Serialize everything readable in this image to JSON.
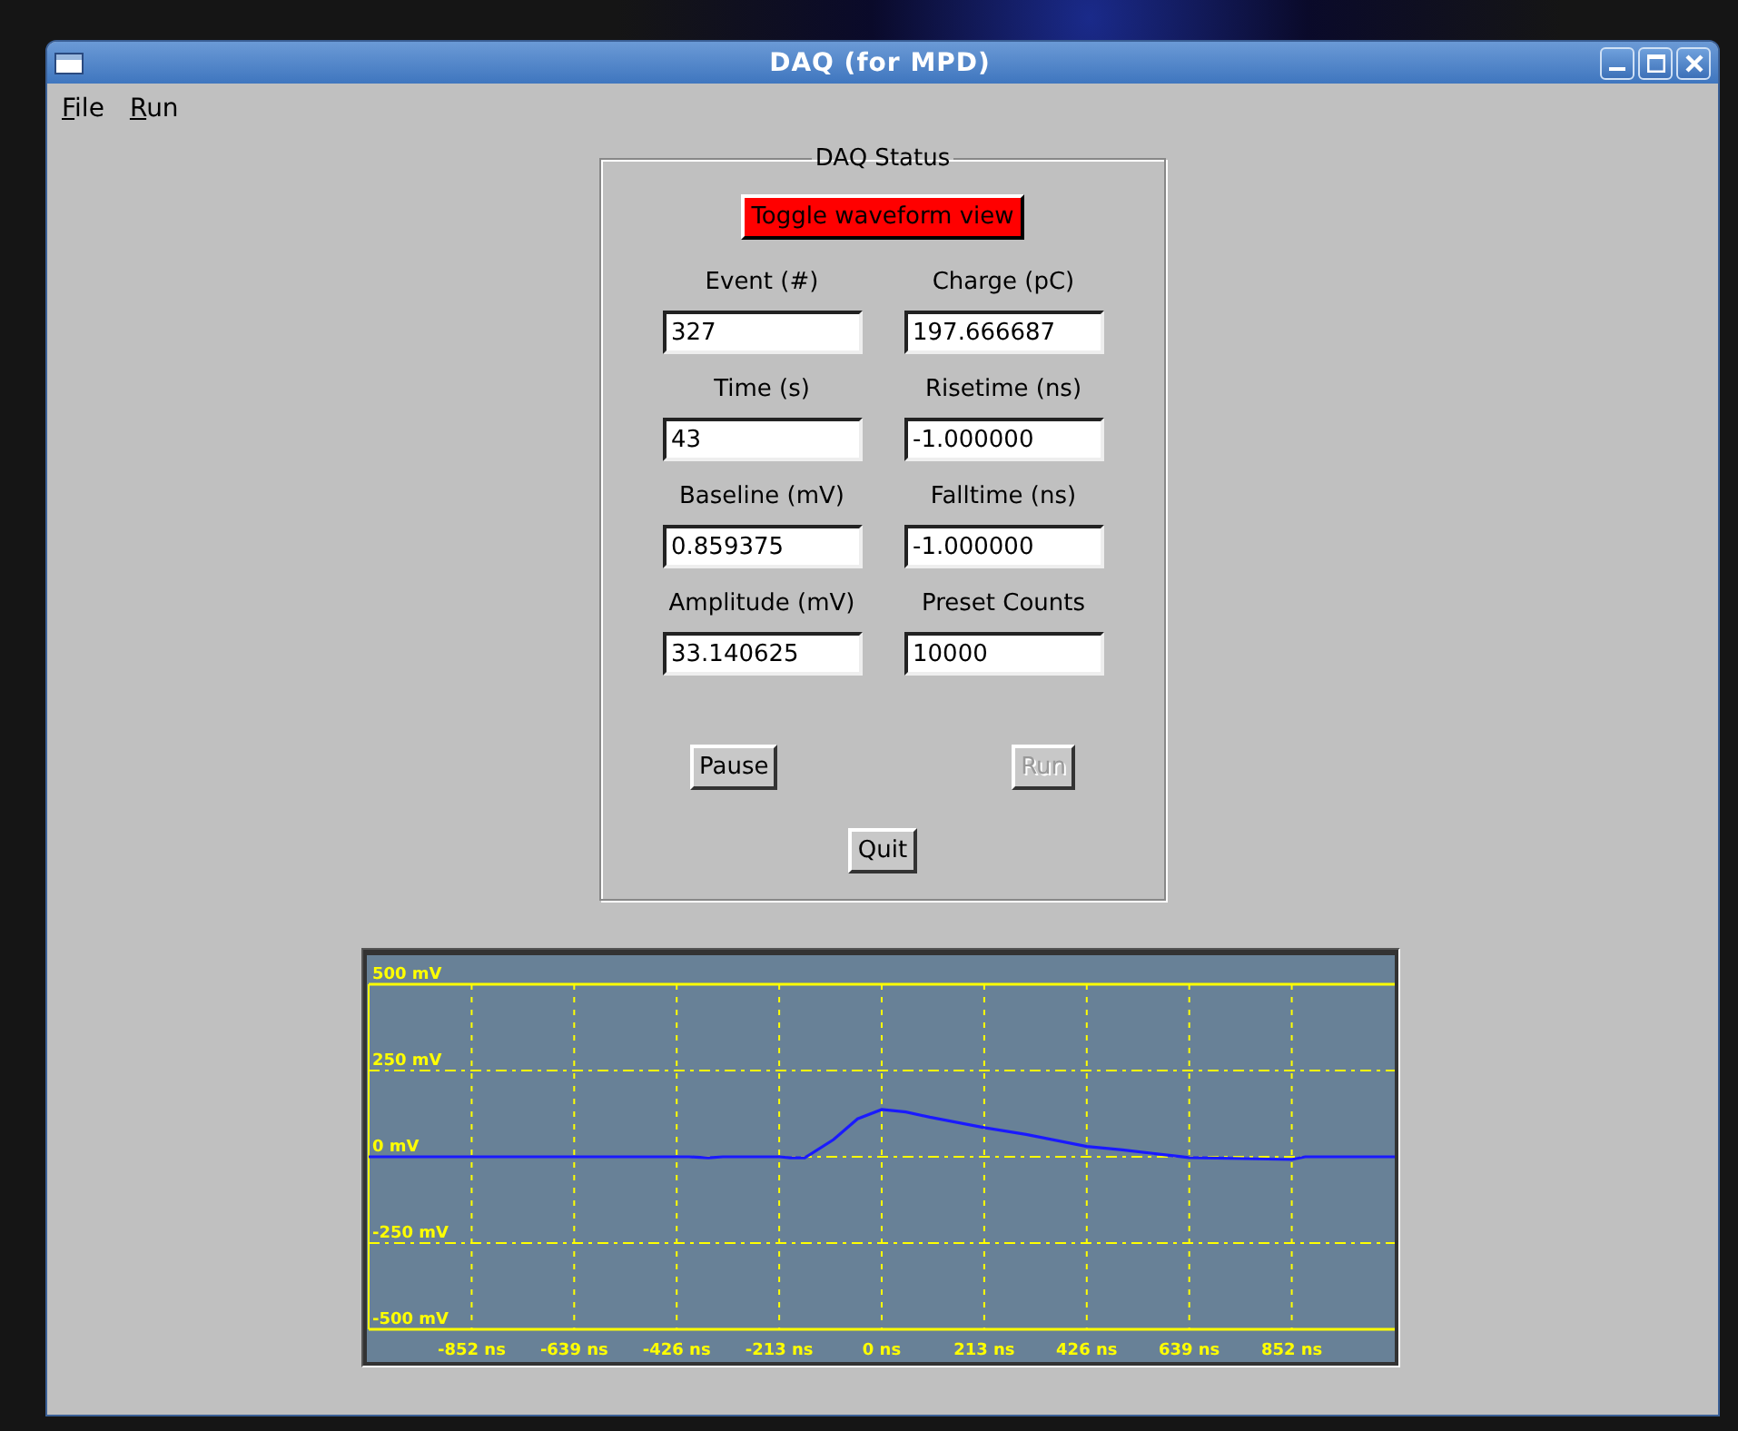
{
  "window": {
    "title": "DAQ (for MPD)"
  },
  "menu": [
    "File",
    "Run"
  ],
  "status_panel": {
    "title": "DAQ Status",
    "toggle_button": "Toggle waveform view",
    "fields": [
      {
        "label": "Event (#)",
        "value": "327"
      },
      {
        "label": "Charge (pC)",
        "value": "197.666687"
      },
      {
        "label": "Time (s)",
        "value": "43"
      },
      {
        "label": "Risetime (ns)",
        "value": "-1.000000"
      },
      {
        "label": "Baseline (mV)",
        "value": "0.859375"
      },
      {
        "label": "Falltime (ns)",
        "value": "-1.000000"
      },
      {
        "label": "Amplitude (mV)",
        "value": "33.140625"
      },
      {
        "label": "Preset Counts",
        "value": "10000"
      }
    ],
    "buttons": [
      {
        "label": "Pause",
        "disabled": false
      },
      {
        "label": "Run",
        "disabled": true
      },
      {
        "label": "Quit",
        "disabled": false
      }
    ]
  },
  "waveform": {
    "chart_data": {
      "type": "line",
      "grid": true,
      "xlim": [
        -1066,
        1066
      ],
      "ylim": [
        -500,
        500
      ],
      "xticks": [
        {
          "value": -852,
          "label": "-852 ns"
        },
        {
          "value": -639,
          "label": "-639 ns"
        },
        {
          "value": -426,
          "label": "-426 ns"
        },
        {
          "value": -213,
          "label": "-213 ns"
        },
        {
          "value": 0,
          "label": "0 ns"
        },
        {
          "value": 213,
          "label": "213 ns"
        },
        {
          "value": 426,
          "label": "426 ns"
        },
        {
          "value": 639,
          "label": "639 ns"
        },
        {
          "value": 852,
          "label": "852 ns"
        }
      ],
      "yticks": [
        {
          "value": 500,
          "label": "500 mV"
        },
        {
          "value": 250,
          "label": "250 mV"
        },
        {
          "value": 0,
          "label": "0 mV"
        },
        {
          "value": -250,
          "label": "-250 mV"
        },
        {
          "value": -500,
          "label": "-500 mV"
        }
      ],
      "x": [
        -1066,
        -400,
        -360,
        -330,
        -213,
        -190,
        -160,
        -100,
        -50,
        0,
        50,
        100,
        213,
        300,
        426,
        500,
        639,
        750,
        852,
        880,
        1066
      ],
      "series": [
        {
          "color": "#1a1aff",
          "values": [
            0,
            0,
            -3,
            0,
            0,
            -3,
            -3,
            50,
            110,
            137,
            130,
            115,
            85,
            65,
            30,
            20,
            -2,
            -5,
            -8,
            0,
            0
          ]
        }
      ]
    }
  }
}
